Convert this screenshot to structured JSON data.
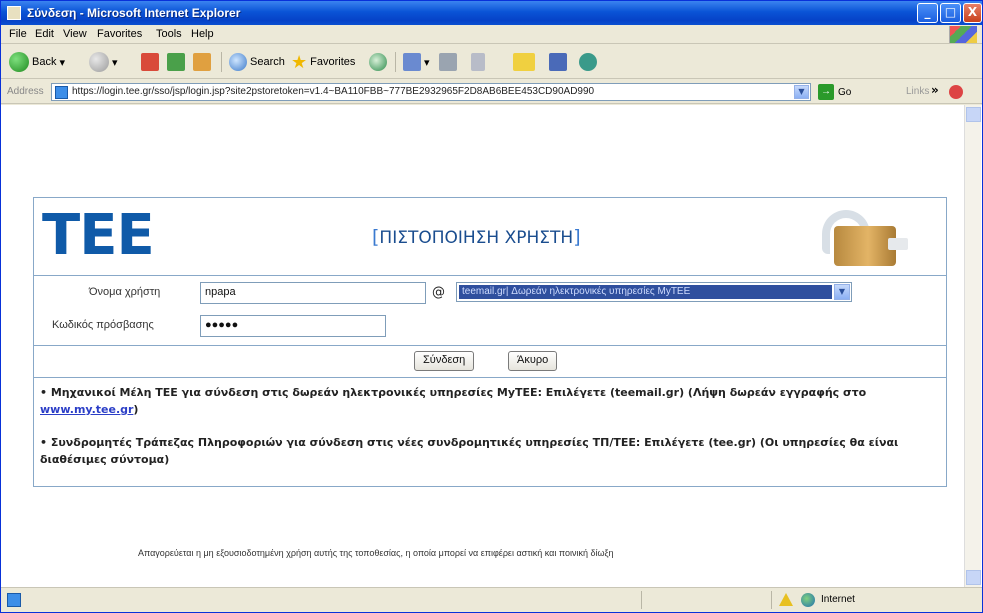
{
  "window": {
    "title": "Σύνδεση - Microsoft Internet Explorer",
    "minimize": "_",
    "maximize": "□",
    "close": "X"
  },
  "menu": [
    "File",
    "Edit",
    "View",
    "Favorites",
    "Tools",
    "Help"
  ],
  "toolbar": {
    "back_label": "Back",
    "search_label": "Search",
    "favorites_label": "Favorites"
  },
  "address": {
    "label": "Address",
    "url": "https://login.tee.gr/sso/jsp/login.jsp?site2pstoretoken=v1.4~BA110FBB~777BE2932965F2D8AB6BEE453CD90AD990",
    "go_label": "Go",
    "links_label": "Links",
    "links_chevron": "»"
  },
  "login": {
    "logo": "TEE",
    "title": "ΠΙΣΤΟΠΟΙΗΣΗ ΧΡΗΣΤΗ",
    "bracket_open": "[",
    "bracket_close": "]",
    "username_label": "Όνομα χρήστη",
    "username_value": "npapa",
    "at_sign": "@",
    "domain_selected": "teemail.gr| Δωρεάν ηλεκτρονικές υπηρεσίες MyTEE",
    "password_label": "Κωδικός πρόσβασης",
    "password_value": "●●●●●",
    "submit_label": "Σύνδεση",
    "cancel_label": "Άκυρο"
  },
  "notes": {
    "note1_text": "•  Μηχανικοί Μέλη ΤΕΕ για σύνδεση στις δωρεάν ηλεκτρονικές υπηρεσίες MyTEE: Επιλέγετε (teemail.gr) (Λήψη δωρεάν εγγραφής στο ",
    "note1_link": "www.my.tee.gr",
    "note1_end": ")",
    "note2_text": "•  Συνδρομητές Τράπεζας Πληροφοριών για σύνδεση στις νέες συνδρομητικές υπηρεσίες ΤΠ/ΤΕΕ: Επιλέγετε (tee.gr) (Οι υπηρεσίες θα είναι διαθέσιμες σύντομα)"
  },
  "footer_note": "Απαγορεύεται η μη εξουσιοδοτημένη χρήση αυτής της τοποθεσίας, η οποία μπορεί να επιφέρει αστική και ποινική δίωξη",
  "status": {
    "zone": "Internet"
  }
}
